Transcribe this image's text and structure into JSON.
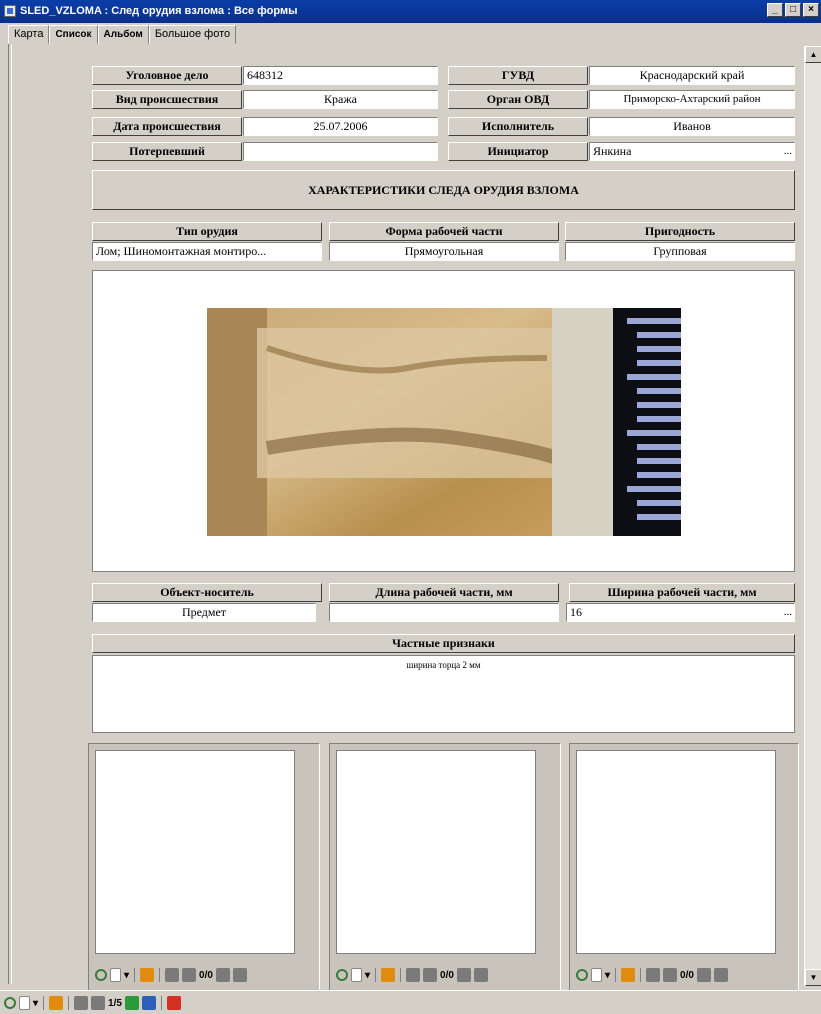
{
  "window": {
    "title": "SLED_VZLOMA : След орудия взлома : Все формы",
    "min": "_",
    "max": "□",
    "close": "×"
  },
  "tabs": [
    {
      "label": "Карта"
    },
    {
      "label": "Список"
    },
    {
      "label": "Альбом"
    },
    {
      "label": "Большое фото"
    }
  ],
  "fields": {
    "case_label": "Уголовное дело",
    "case_value": "648312",
    "type_label": "Вид происшествия",
    "type_value": "Кража",
    "date_label": "Дата происшествия",
    "date_value": "25.07.2006",
    "victim_label": "Потерпевший",
    "victim_value": "",
    "guvd_label": "ГУВД",
    "guvd_value": "Краснодарский край",
    "ovd_label": "Орган ОВД",
    "ovd_value": "Приморско-Ахтарский район",
    "executor_label": "Исполнитель",
    "executor_value": "Иванов",
    "initiator_label": "Инициатор",
    "initiator_value": "Янкина"
  },
  "section_title": "ХАРАКТЕРИСТИКИ СЛЕДА ОРУДИЯ ВЗЛОМА",
  "characteristics": {
    "tool_type_label": "Тип орудия",
    "tool_type_value": "Лом; Шиномонтажная монтиро...",
    "shape_label": "Форма рабочей части",
    "shape_value": "Прямоугольная",
    "suitability_label": "Пригодность",
    "suitability_value": "Групповая"
  },
  "details": {
    "carrier_label": "Объект-носитель",
    "carrier_value": "Предмет",
    "length_label": "Длина рабочей части, мм",
    "length_value": "",
    "width_label": "Ширина рабочей части, мм",
    "width_value": "16",
    "features_label": "Частные признаки",
    "features_value": "ширина торца 2 мм"
  },
  "ellipsis": "...",
  "subforms": [
    {
      "counter": "0/0"
    },
    {
      "counter": "0/0"
    },
    {
      "counter": "0/0"
    }
  ],
  "main_nav": {
    "counter": "1/5"
  }
}
